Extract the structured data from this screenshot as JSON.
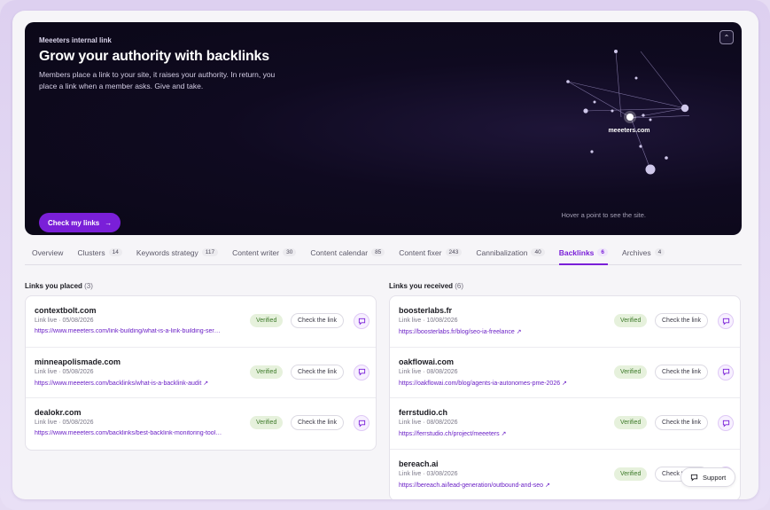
{
  "hero": {
    "kicker": "Meeeters internal link",
    "title": "Grow your authority with backlinks",
    "description": "Members place a link to your site, it raises your authority. In return, you place a link when a member asks. Give and take.",
    "cta_label": "Check my links",
    "network_label": "meeeters.com",
    "hint": "Hover a point to see the site."
  },
  "tabs": [
    {
      "label": "Overview",
      "count": ""
    },
    {
      "label": "Clusters",
      "count": "14"
    },
    {
      "label": "Keywords strategy",
      "count": "117"
    },
    {
      "label": "Content writer",
      "count": "30"
    },
    {
      "label": "Content calendar",
      "count": "85"
    },
    {
      "label": "Content fixer",
      "count": "243"
    },
    {
      "label": "Cannibalization",
      "count": "40"
    },
    {
      "label": "Backlinks",
      "count": "6"
    },
    {
      "label": "Archives",
      "count": "4"
    }
  ],
  "placed": {
    "title": "Links you placed",
    "count": "(3)",
    "rows": [
      {
        "domain": "contextbolt.com",
        "status": "Link live · 05/08/2026",
        "url": "https://www.meeeters.com/link-building/what-is-a-link-building-ser…",
        "badge": "Verified",
        "action": "Check the link"
      },
      {
        "domain": "minneapolismade.com",
        "status": "Link live · 05/08/2026",
        "url": "https://www.meeeters.com/backlinks/what-is-a-backlink-audit ↗",
        "badge": "Verified",
        "action": "Check the link"
      },
      {
        "domain": "dealokr.com",
        "status": "Link live · 05/08/2026",
        "url": "https://www.meeeters.com/backlinks/best-backlink-monitoring-tool…",
        "badge": "Verified",
        "action": "Check the link"
      }
    ]
  },
  "received": {
    "title": "Links you received",
    "count": "(6)",
    "rows": [
      {
        "domain": "boosterlabs.fr",
        "status": "Link live · 10/08/2026",
        "url": "https://boosterlabs.fr/blog/seo-ia-freelance ↗",
        "badge": "Verified",
        "action": "Check the link"
      },
      {
        "domain": "oakflowai.com",
        "status": "Link live · 08/08/2026",
        "url": "https://oakflowai.com/blog/agents-ia-autonomes-pme-2026 ↗",
        "badge": "Verified",
        "action": "Check the link"
      },
      {
        "domain": "ferrstudio.ch",
        "status": "Link live · 08/08/2026",
        "url": "https://ferrstudio.ch/project/meeeters ↗",
        "badge": "Verified",
        "action": "Check the link"
      },
      {
        "domain": "bereach.ai",
        "status": "Link live · 03/08/2026",
        "url": "https://bereach.ai/lead-generation/outbound-and-seo ↗",
        "badge": "Verified",
        "action": "Check the link"
      }
    ]
  },
  "support_label": "Support",
  "colors": {
    "accent": "#7a1fd8",
    "verified_bg": "#e6f1dc",
    "verified_fg": "#3d7a2a",
    "hero_bg": "#0f0a20"
  }
}
